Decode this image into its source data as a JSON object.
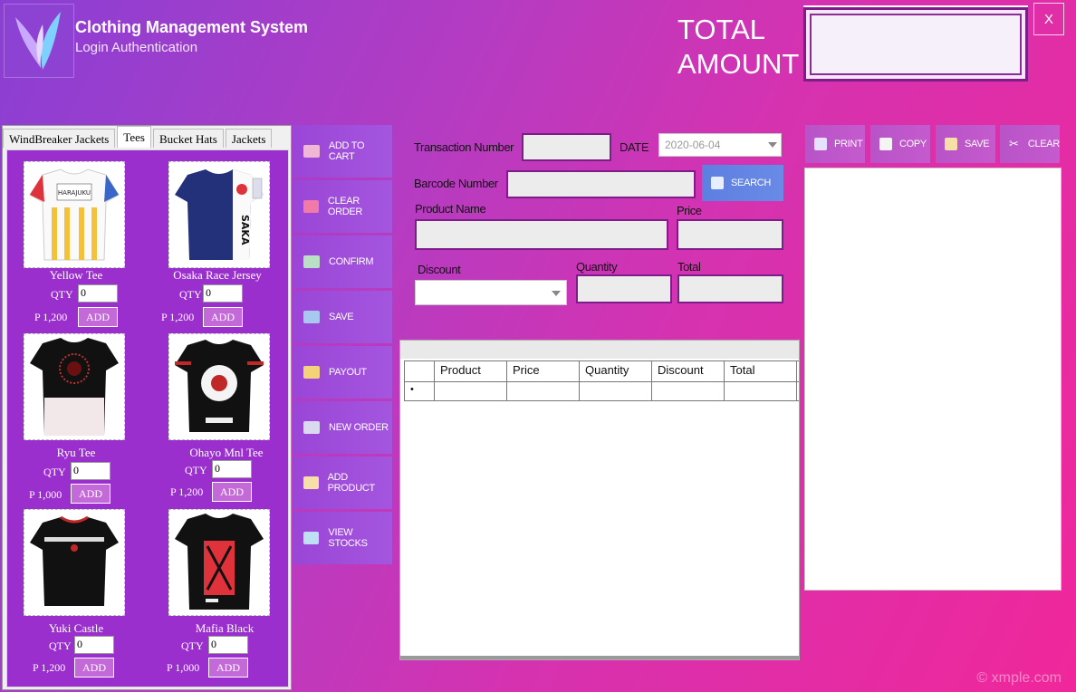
{
  "header": {
    "title": "Clothing Management System",
    "subtitle": "Login Authentication",
    "total_label_line1": "TOTAL",
    "total_label_line2": "AMOUNT",
    "total_value": "",
    "close_label": "X"
  },
  "catalog": {
    "tabs": [
      "WindBreaker Jackets",
      "Tees",
      "Bucket Hats",
      "Jackets"
    ],
    "active_tab": "Tees",
    "qty_label": "QTY",
    "add_label": "ADD",
    "products": [
      {
        "name": "Yellow Tee",
        "qty": "0",
        "price": "P 1,200"
      },
      {
        "name": "Osaka Race Jersey",
        "qty": "0",
        "price": "P 1,200"
      },
      {
        "name": "Ryu Tee",
        "qty": "0",
        "price": "P 1,000"
      },
      {
        "name": "Ohayo Mnl Tee",
        "qty": "0",
        "price": "P 1,200"
      },
      {
        "name": "Yuki Castle",
        "qty": "0",
        "price": "P 1,200"
      },
      {
        "name": "Mafia Black",
        "qty": "0",
        "price": "P 1,000"
      }
    ]
  },
  "commands": [
    {
      "label": "ADD TO CART",
      "icon": "cart-icon",
      "color": "#f0b8d4"
    },
    {
      "label": "CLEAR ORDER",
      "icon": "eraser-icon",
      "color": "#f27aa8"
    },
    {
      "label": "CONFIRM",
      "icon": "check-icon",
      "color": "#b9e0c4"
    },
    {
      "label": "SAVE",
      "icon": "save-icon",
      "color": "#a8c8f0"
    },
    {
      "label": "PAYOUT",
      "icon": "payout-icon",
      "color": "#f3d27a"
    },
    {
      "label": "NEW ORDER",
      "icon": "new-order-icon",
      "color": "#d9d9ef"
    },
    {
      "label": "ADD PRODUCT",
      "icon": "add-product-icon",
      "color": "#f6e0a8"
    },
    {
      "label": "VIEW STOCKS",
      "icon": "stocks-icon",
      "color": "#bfe0f4"
    }
  ],
  "form": {
    "transaction_label": "Transaction Number",
    "transaction_value": "",
    "date_label": "DATE",
    "date_value": "2020-06-04",
    "barcode_label": "Barcode Number",
    "barcode_value": "",
    "search_label": "SEARCH",
    "product_name_label": "Product Name",
    "product_name_value": "",
    "price_label": "Price",
    "price_value": "",
    "discount_label": "Discount",
    "discount_value": "",
    "quantity_label": "Quantity",
    "quantity_value": "",
    "total_label": "Total",
    "total_value": ""
  },
  "grid": {
    "columns": [
      "Product",
      "Price",
      "Quantity",
      "Discount",
      "Total"
    ],
    "new_row_marker": "•"
  },
  "receipt_toolbar": [
    {
      "label": "PRINT",
      "icon": "print-icon"
    },
    {
      "label": "COPY",
      "icon": "copy-icon"
    },
    {
      "label": "SAVE",
      "icon": "save-icon"
    },
    {
      "label": "CLEAR",
      "icon": "scissors-icon"
    }
  ],
  "watermark": "© xmple.com"
}
